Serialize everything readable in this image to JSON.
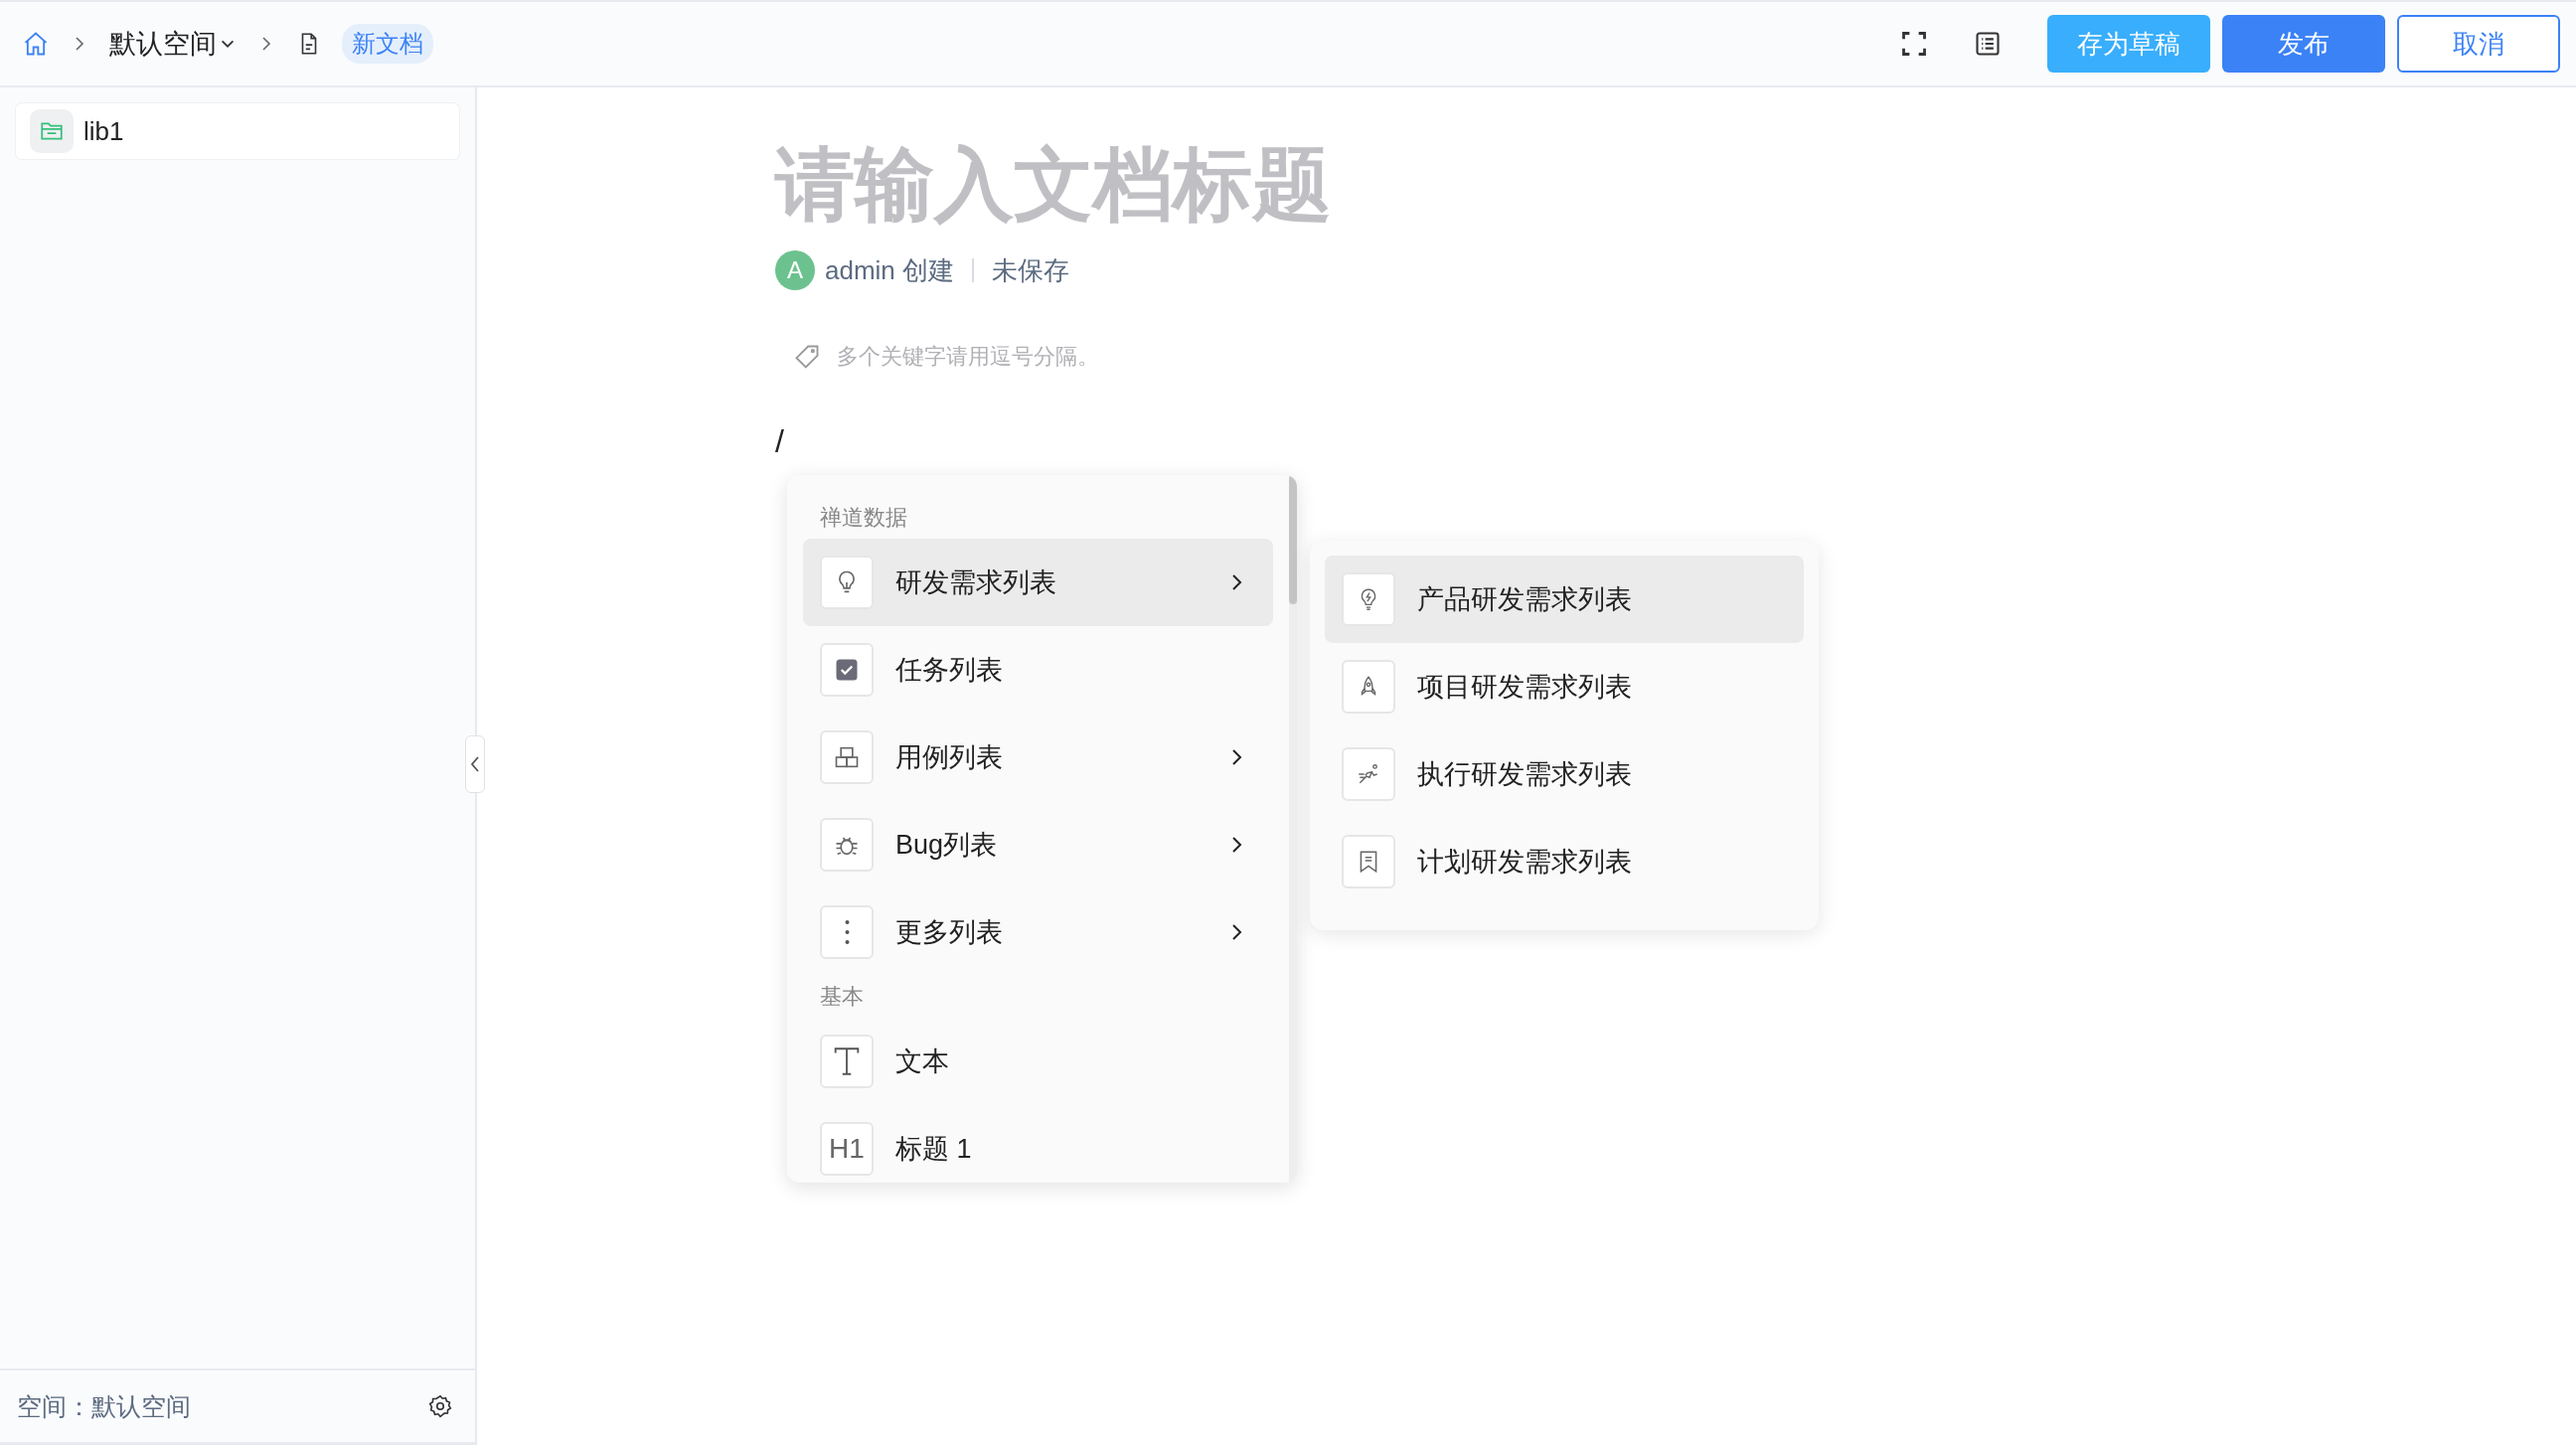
{
  "breadcrumb": {
    "space": "默认空间",
    "document": "新文档"
  },
  "toolbar": {
    "buttons": [
      {
        "label": "存为草稿",
        "kind": "draft"
      },
      {
        "label": "发布",
        "kind": "primary"
      },
      {
        "label": "取消",
        "kind": "outline"
      }
    ]
  },
  "sidebar": {
    "items": [
      {
        "label": "lib1",
        "selected": true
      }
    ],
    "footer": "空间：默认空间"
  },
  "document": {
    "title_placeholder": "请输入文档标题",
    "author_initial": "A",
    "author": "admin 创建",
    "status": "未保存",
    "keywords_placeholder": "多个关键字请用逗号分隔。",
    "content": "/"
  },
  "slash_menu": {
    "groups": [
      {
        "heading": "禅道数据",
        "items": [
          {
            "label": "研发需求列表",
            "kind": "bulb",
            "submenu": true,
            "selected": true
          },
          {
            "label": "任务列表",
            "kind": "checkbox",
            "submenu": false,
            "selected": false
          },
          {
            "label": "用例列表",
            "kind": "blocks",
            "submenu": true,
            "selected": false
          },
          {
            "label": "Bug列表",
            "kind": "bug",
            "submenu": true,
            "selected": false
          },
          {
            "label": "更多列表",
            "kind": "dots",
            "submenu": true,
            "selected": false
          }
        ]
      },
      {
        "heading": "基本",
        "items": [
          {
            "label": "文本",
            "kind": "text",
            "submenu": false,
            "selected": false
          },
          {
            "label": "标题 1",
            "kind": "glyph",
            "icon_text": "H1",
            "submenu": false,
            "selected": false
          }
        ]
      }
    ]
  },
  "submenu": {
    "items": [
      {
        "label": "产品研发需求列表",
        "kind": "bulb-bolt",
        "selected": true
      },
      {
        "label": "项目研发需求列表",
        "kind": "rocket",
        "selected": false
      },
      {
        "label": "执行研发需求列表",
        "kind": "runner",
        "selected": false
      },
      {
        "label": "计划研发需求列表",
        "kind": "bookmark",
        "selected": false
      }
    ]
  }
}
